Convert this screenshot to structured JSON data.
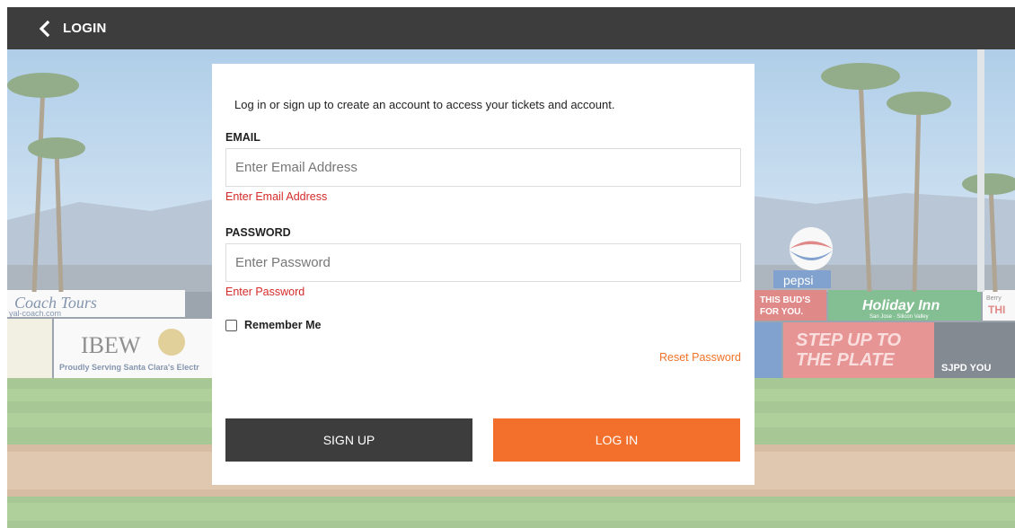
{
  "topbar": {
    "title": "LOGIN",
    "back_icon": "chevron-left-icon"
  },
  "background": {
    "signs": {
      "coach_tours": "Coach Tours",
      "coach_url": "yal-coach.com",
      "ibew": "IBEW",
      "ibew_sub": "Proudly Serving Santa Clara's Electr",
      "pepsi": "pepsi",
      "this_buds": "THIS BUD'S",
      "for_you": "FOR YOU.",
      "holiday_inn": "Holiday Inn",
      "holiday_sub": "San Jose · Silicon Valley",
      "berry": "Berry",
      "thi": "THI",
      "step_up": "STEP UP TO",
      "the_plate": "THE PLATE",
      "sjpd": "SJPD YOU"
    }
  },
  "form": {
    "intro": "Log in or sign up to create an account to access your tickets and account.",
    "email": {
      "label": "EMAIL",
      "placeholder": "Enter Email Address",
      "value": "",
      "error": "Enter Email Address"
    },
    "password": {
      "label": "PASSWORD",
      "placeholder": "Enter Password",
      "value": "",
      "error": "Enter Password"
    },
    "remember": {
      "label": "Remember Me",
      "checked": false
    },
    "reset_link": "Reset Password",
    "signup_button": "SIGN UP",
    "login_button": "LOG IN"
  },
  "colors": {
    "topbar": "#3d3d3d",
    "accent": "#f2702b",
    "error": "#d42a2a",
    "signup": "#3d3d3d"
  }
}
